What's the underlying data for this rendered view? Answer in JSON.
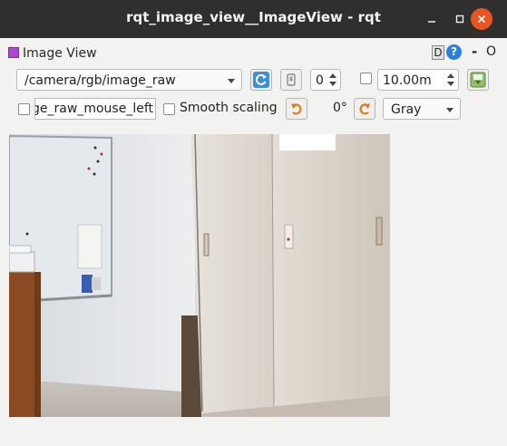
{
  "window": {
    "title": "rqt_image_view__ImageView - rqt",
    "minimize_icon": "minimize-icon",
    "maximize_icon": "maximize-icon",
    "close_icon": "close-icon",
    "close_color": "#e95420"
  },
  "panel": {
    "title": "Image View",
    "d_label": "D",
    "help_label": "?",
    "dash_label": "-",
    "o_label": "O"
  },
  "toolbar": {
    "topic": "/camera/rgb/image_raw",
    "refresh_icon": "refresh-icon",
    "zoom_icon": "zoom-icon",
    "num_value": "0",
    "distance_value": "10.00m",
    "save_icon": "save-image-icon",
    "mouse_topic": "ge_raw_mouse_left",
    "smooth_scaling_label": "Smooth scaling",
    "rotate_left_icon": "rotate-left-icon",
    "rotation_label": "0°",
    "rotate_right_icon": "rotate-right-icon",
    "color_scheme": "Gray"
  },
  "image": {
    "description_icon": "camera-image"
  }
}
